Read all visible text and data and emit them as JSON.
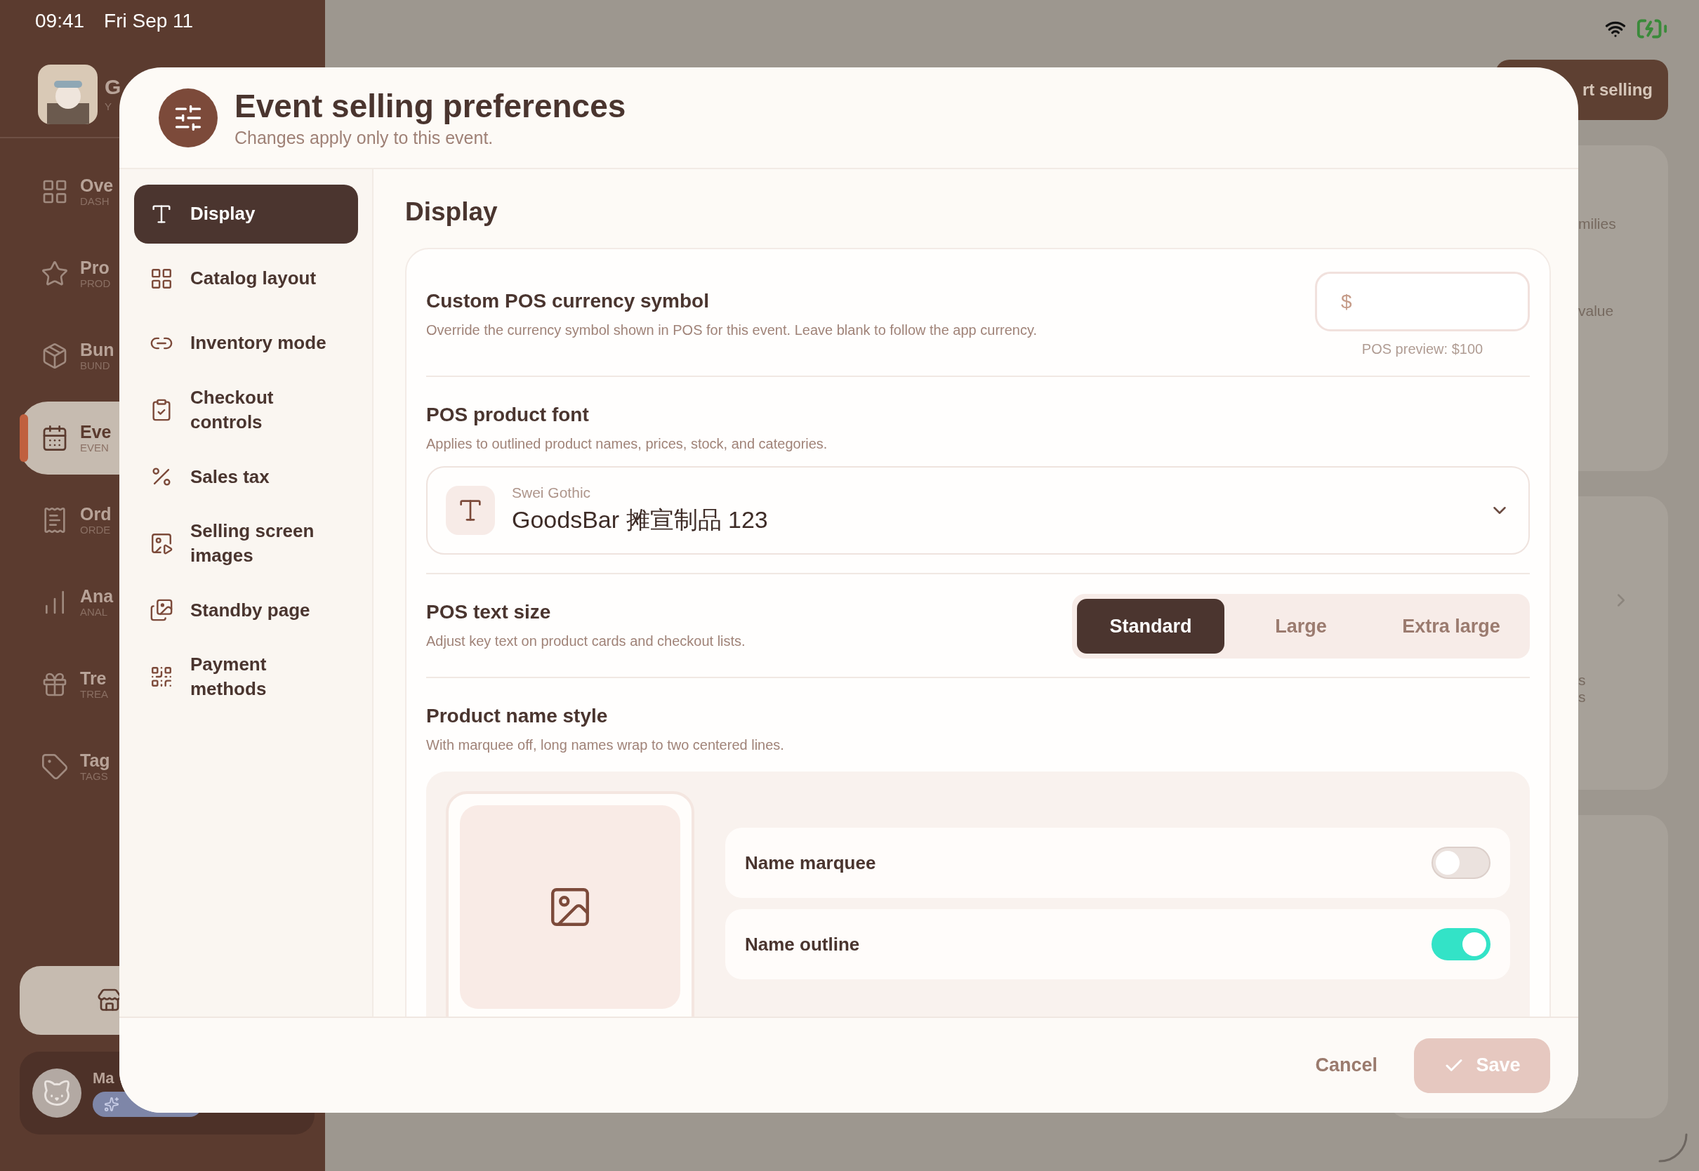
{
  "status_bar": {
    "time": "09:41",
    "date": "Fri Sep 11"
  },
  "app_sidebar": {
    "title_fragment": "G",
    "subtitle_fragment": "Y",
    "items": [
      {
        "label": "Ove",
        "caption": "DASH",
        "selected": false
      },
      {
        "label": "Pro",
        "caption": "PROD",
        "selected": false
      },
      {
        "label": "Bun",
        "caption": "BUND",
        "selected": false
      },
      {
        "label": "Eve",
        "caption": "EVEN",
        "selected": true
      },
      {
        "label": "Ord",
        "caption": "ORDE",
        "selected": false
      },
      {
        "label": "Ana",
        "caption": "ANAL",
        "selected": false
      },
      {
        "label": "Tre",
        "caption": "TREA",
        "selected": false
      },
      {
        "label": "Tag",
        "caption": "TAGS",
        "selected": false
      }
    ],
    "user": {
      "name_fragment": "Ma"
    }
  },
  "background": {
    "start_button": "rt selling",
    "fragments": [
      "milies",
      "value"
    ],
    "list_fragments": [
      "s",
      "s"
    ]
  },
  "modal": {
    "title": "Event selling preferences",
    "subtitle": "Changes apply only to this event.",
    "nav": [
      {
        "label": "Display",
        "selected": true
      },
      {
        "label": "Catalog layout",
        "selected": false
      },
      {
        "label": "Inventory mode",
        "selected": false
      },
      {
        "label": "Checkout controls",
        "selected": false
      },
      {
        "label": "Sales tax",
        "selected": false
      },
      {
        "label": "Selling screen images",
        "selected": false
      },
      {
        "label": "Standby page",
        "selected": false
      },
      {
        "label": "Payment methods",
        "selected": false
      }
    ],
    "section_title": "Display",
    "settings": [
      {
        "kind": "text_input",
        "title": "Custom POS currency symbol",
        "description": "Override the currency symbol shown in POS for this event. Leave blank to follow the app currency.",
        "placeholder": "$",
        "hint": "POS preview: $100"
      },
      {
        "kind": "select",
        "title": "POS product font",
        "description": "Applies to outlined product names, prices, stock, and categories.",
        "font_name": "Swei Gothic",
        "sample": "GoodsBar 摊宣制品 123"
      },
      {
        "kind": "segmented",
        "title": "POS text size",
        "description": "Adjust key text on product cards and checkout lists.",
        "options": [
          {
            "label": "Standard",
            "selected": true
          },
          {
            "label": "Large",
            "selected": false
          },
          {
            "label": "Extra large",
            "selected": false
          }
        ]
      },
      {
        "kind": "name_style",
        "title": "Product name style",
        "description": "With marquee off, long names wrap to two centered lines.",
        "toggles": [
          {
            "label": "Name marquee",
            "on": false
          },
          {
            "label": "Name outline",
            "on": true
          }
        ]
      }
    ],
    "footer": {
      "cancel": "Cancel",
      "save": "Save"
    }
  }
}
